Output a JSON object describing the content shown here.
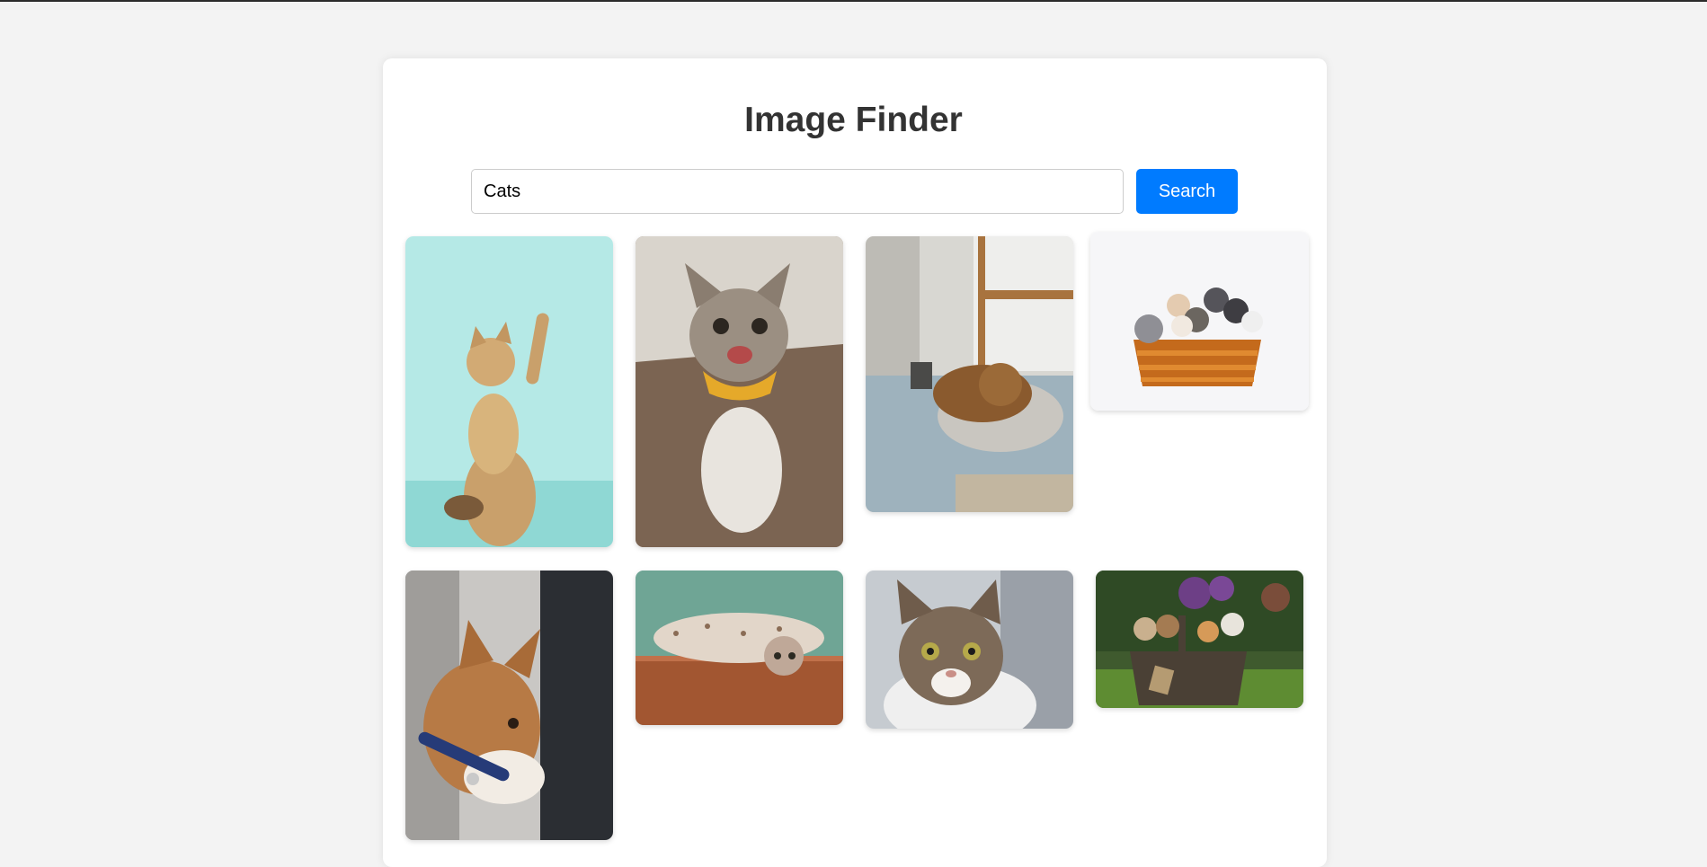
{
  "page": {
    "title": "Image Finder"
  },
  "search": {
    "value": "Cats",
    "button_label": "Search"
  },
  "results": [
    {
      "subject": "orange-kitten-raising-paw"
    },
    {
      "subject": "tabby-cat-with-yellow-bandana"
    },
    {
      "subject": "sleeping-cat-on-blanket"
    },
    {
      "subject": "kittens-in-basket-white-background"
    },
    {
      "subject": "ginger-cat-with-blue-collar"
    },
    {
      "subject": "cat-lying-on-wooden-floor"
    },
    {
      "subject": "tabby-cat-portrait"
    },
    {
      "subject": "kittens-in-basket-on-grass"
    }
  ],
  "colors": {
    "accent": "#007bff",
    "background": "#f3f3f3",
    "card": "#ffffff",
    "title": "#333333"
  }
}
